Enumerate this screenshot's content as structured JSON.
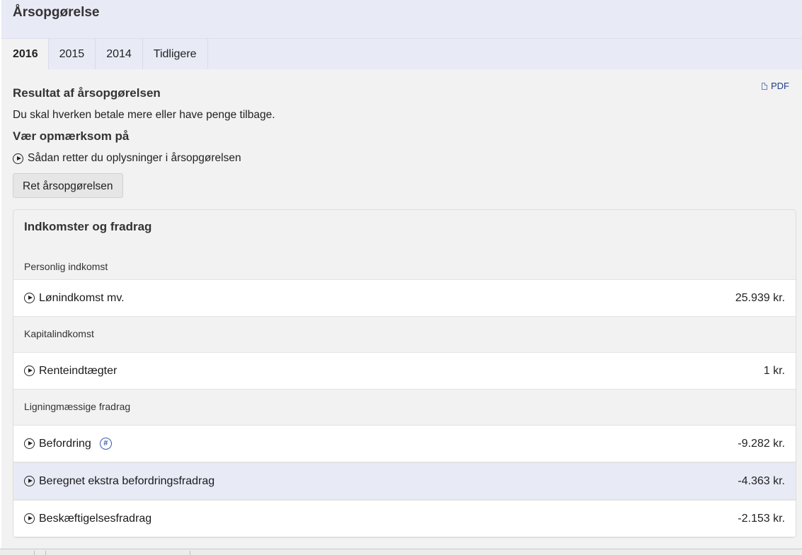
{
  "header": {
    "title": "Årsopgørelse"
  },
  "tabs": [
    {
      "label": "2016",
      "active": true
    },
    {
      "label": "2015",
      "active": false
    },
    {
      "label": "2014",
      "active": false
    },
    {
      "label": "Tidligere",
      "active": false
    }
  ],
  "pdf_link": {
    "label": "PDF",
    "icon": "document-icon"
  },
  "result": {
    "heading": "Resultat af årsopgørelsen",
    "text": "Du skal hverken betale mere eller have penge tilbage."
  },
  "attention": {
    "heading": "Vær opmærksom på",
    "link": "Sådan retter du oplysninger i årsopgørelsen"
  },
  "edit_button": "Ret årsopgørelsen",
  "panel": {
    "title": "Indkomster og fradrag",
    "sections": [
      {
        "label": "Personlig indkomst",
        "rows": [
          {
            "label": "Lønindkomst mv.",
            "amount": "25.939 kr."
          }
        ]
      },
      {
        "label": "Kapitalindkomst",
        "rows": [
          {
            "label": "Renteindtægter",
            "amount": "1 kr."
          }
        ]
      },
      {
        "label": "Ligningmæssige fradrag",
        "rows": [
          {
            "label": "Befordring",
            "amount": "-9.282 kr.",
            "badge": "#"
          },
          {
            "label": "Beregnet ekstra befordringsfradrag",
            "amount": "-4.363 kr."
          },
          {
            "label": "Beskæftigelsesfradrag",
            "amount": "-2.153 kr."
          }
        ]
      }
    ]
  },
  "colors": {
    "header_bg": "#e8eaf6",
    "highlight_row": "#e8eaf6",
    "link": "#1f3b8a"
  }
}
